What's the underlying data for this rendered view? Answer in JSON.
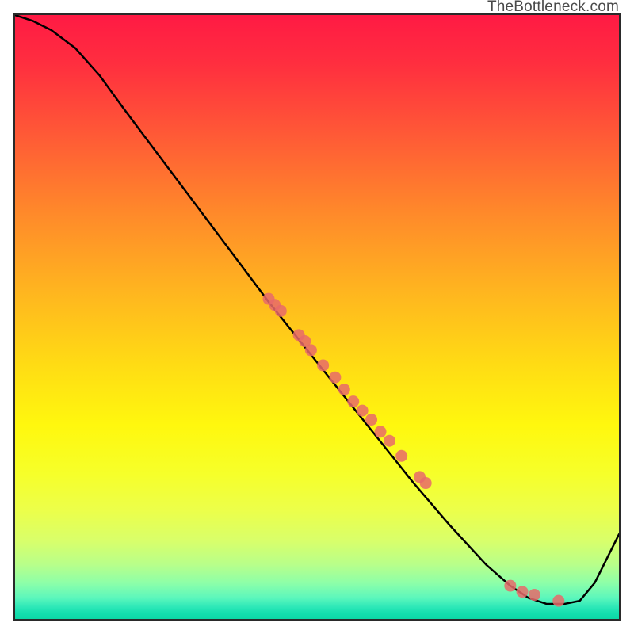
{
  "attribution": "TheBottleneck.com",
  "chart_data": {
    "type": "line",
    "title": "",
    "xlabel": "",
    "ylabel": "",
    "xlim": [
      0,
      100
    ],
    "ylim": [
      0,
      100
    ],
    "grid": false,
    "legend": false,
    "note": "Axes have no visible tick labels; x/y values are estimated in 0–100 space from pixel positions.",
    "series": [
      {
        "name": "curve",
        "style": "line",
        "color": "#000000",
        "x": [
          0,
          3,
          6,
          10,
          14,
          18,
          24,
          30,
          36,
          42,
          48,
          54,
          60,
          66,
          72,
          78,
          82,
          85,
          88,
          91,
          93.5,
          96,
          98,
          100
        ],
        "y": [
          100,
          99,
          97.5,
          94.5,
          90,
          84.5,
          76.5,
          68.5,
          60.5,
          52.5,
          45,
          37.5,
          30,
          22.5,
          15.5,
          9,
          5.5,
          3.5,
          2.5,
          2.5,
          3,
          6,
          10,
          14
        ]
      },
      {
        "name": "points",
        "style": "scatter",
        "color": "#e86a6a",
        "x": [
          42,
          43,
          44,
          47,
          48,
          49,
          51,
          53,
          54.5,
          56,
          57.5,
          59,
          60.5,
          62,
          64,
          67,
          68,
          82,
          84,
          86,
          90
        ],
        "y": [
          53,
          52,
          51,
          47,
          46,
          44.5,
          42,
          40,
          38,
          36,
          34.5,
          33,
          31,
          29.5,
          27,
          23.5,
          22.5,
          5.5,
          4.5,
          4,
          3
        ]
      }
    ],
    "background_gradient": {
      "direction": "top-to-bottom",
      "stops": [
        {
          "pos": 0.0,
          "color": "#ff1a44"
        },
        {
          "pos": 0.33,
          "color": "#ff8a2a"
        },
        {
          "pos": 0.66,
          "color": "#fff80e"
        },
        {
          "pos": 0.9,
          "color": "#b8ff8a"
        },
        {
          "pos": 1.0,
          "color": "#0cd8a6"
        }
      ]
    }
  }
}
